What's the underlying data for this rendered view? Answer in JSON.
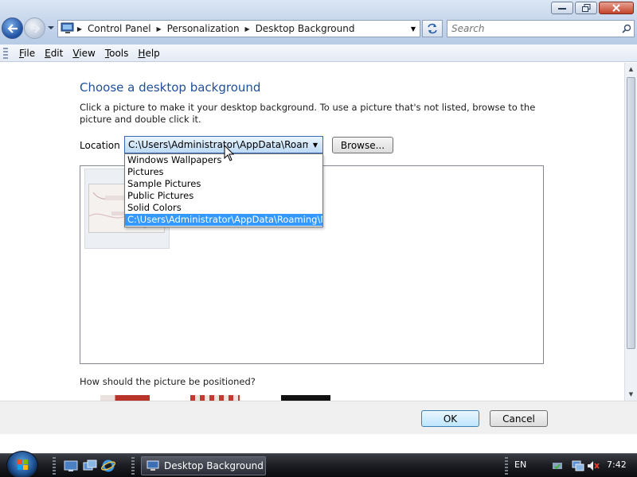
{
  "window": {
    "address": {
      "crumbs": [
        "Control Panel",
        "Personalization",
        "Desktop Background"
      ]
    },
    "search_placeholder": "Search",
    "controls": [
      "minimize",
      "maximize",
      "close"
    ]
  },
  "menu": {
    "items": [
      {
        "accel": "F",
        "rest": "ile"
      },
      {
        "accel": "E",
        "rest": "dit"
      },
      {
        "accel": "V",
        "rest": "iew"
      },
      {
        "accel": "T",
        "rest": "ools"
      },
      {
        "accel": "H",
        "rest": "elp"
      }
    ]
  },
  "main": {
    "heading": "Choose a desktop background",
    "description": "Click a picture to make it your desktop background. To use a picture that's not listed, browse to the picture and double click it.",
    "location_label": "Location",
    "location_value": "C:\\Users\\Administrator\\AppData\\Roaming",
    "browse_label": "Browse...",
    "dropdown_options": [
      "Windows Wallpapers",
      "Pictures",
      "Sample Pictures",
      "Public Pictures",
      "Solid Colors",
      "C:\\Users\\Administrator\\AppData\\Roaming\\Mi"
    ],
    "selected_option_index": 5,
    "position_question": "How should the picture be positioned?"
  },
  "footer": {
    "ok_label": "OK",
    "cancel_label": "Cancel"
  },
  "taskbar": {
    "task_label": "Desktop Background",
    "language": "EN",
    "clock": "7:42"
  },
  "colors": {
    "heading": "#1f4f9c",
    "selection": "#3399ff",
    "taskbar": "#1b1d22"
  }
}
